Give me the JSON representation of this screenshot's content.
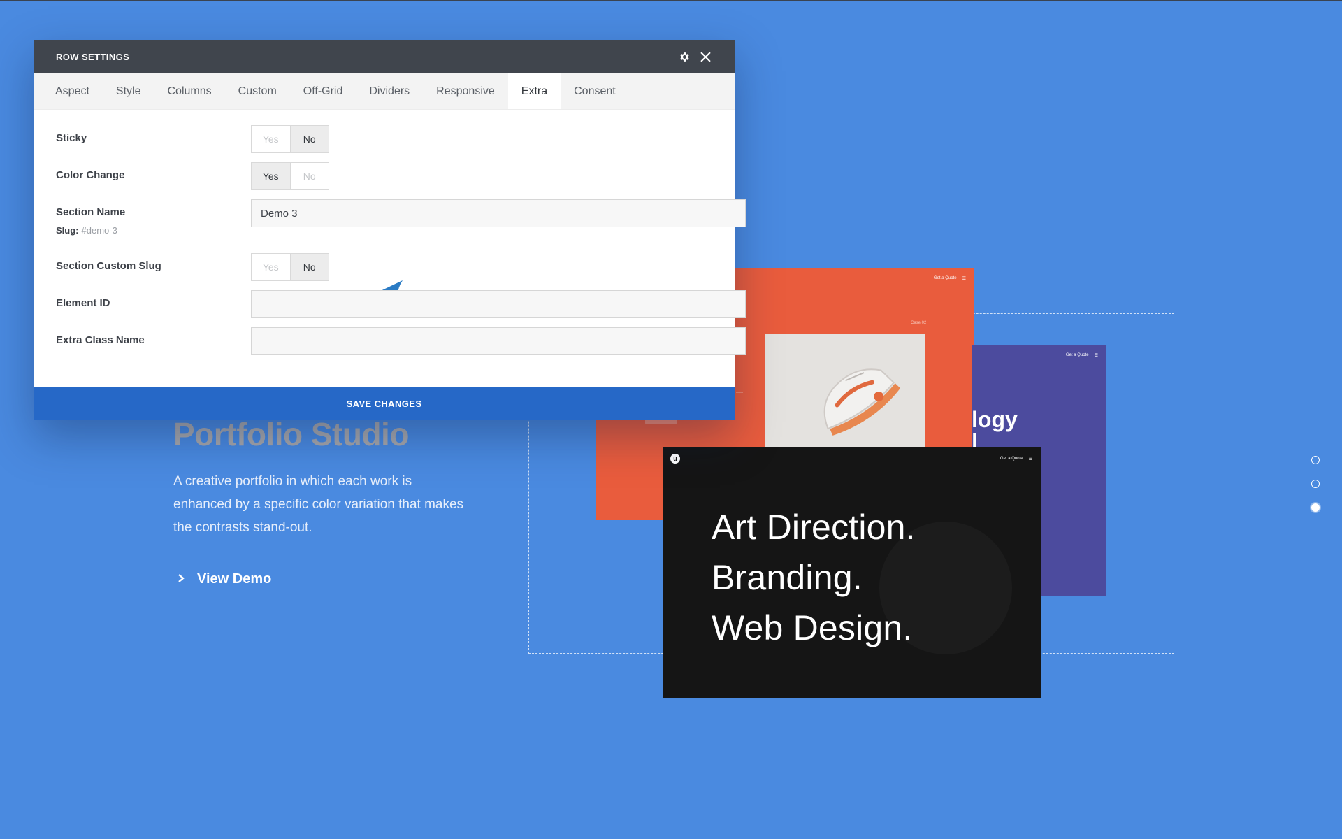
{
  "modal": {
    "title": "ROW SETTINGS",
    "tabs": [
      {
        "label": "Aspect"
      },
      {
        "label": "Style"
      },
      {
        "label": "Columns"
      },
      {
        "label": "Custom"
      },
      {
        "label": "Off-Grid"
      },
      {
        "label": "Dividers"
      },
      {
        "label": "Responsive"
      },
      {
        "label": "Extra",
        "active": true
      },
      {
        "label": "Consent"
      }
    ],
    "fields": {
      "sticky": {
        "label": "Sticky",
        "yes": "Yes",
        "no": "No",
        "selected": "No"
      },
      "color_change": {
        "label": "Color Change",
        "yes": "Yes",
        "no": "No",
        "selected": "Yes"
      },
      "section_name": {
        "label": "Section Name",
        "value": "Demo 3",
        "slug_label": "Slug:",
        "slug_value": "#demo-3"
      },
      "section_custom_slug": {
        "label": "Section Custom Slug",
        "yes": "Yes",
        "no": "No",
        "selected": "No"
      },
      "element_id": {
        "label": "Element ID",
        "value": ""
      },
      "extra_class_name": {
        "label": "Extra Class Name",
        "value": ""
      }
    },
    "save_label": "SAVE CHANGES"
  },
  "hero": {
    "title": "Portfolio Studio",
    "description": "A creative portfolio in which each work is enhanced by a specific color variation that makes the contrasts stand-out.",
    "cta": "View Demo"
  },
  "preview": {
    "orange_card": {
      "nav_label": "Get a Quote",
      "label": "Case 02"
    },
    "purple_card": {
      "nav_label": "Get a Quote",
      "partial_heading_1": "logy",
      "partial_heading_2": "l"
    },
    "dark_card": {
      "logo": "u",
      "nav_label": "Get a Quote",
      "headline": [
        "Art Direction.",
        "Branding.",
        "Web Design."
      ]
    }
  },
  "slider": {
    "dot_count": 3,
    "active_index": 2
  },
  "colors": {
    "background": "#4a8ae0",
    "modal_header": "#40454d",
    "save_button": "#2668c7",
    "annotation_arrow": "#2a7bc4",
    "orange_card": "#e95c3d",
    "purple_card": "#4c4b9e",
    "dark_card": "#151515"
  }
}
